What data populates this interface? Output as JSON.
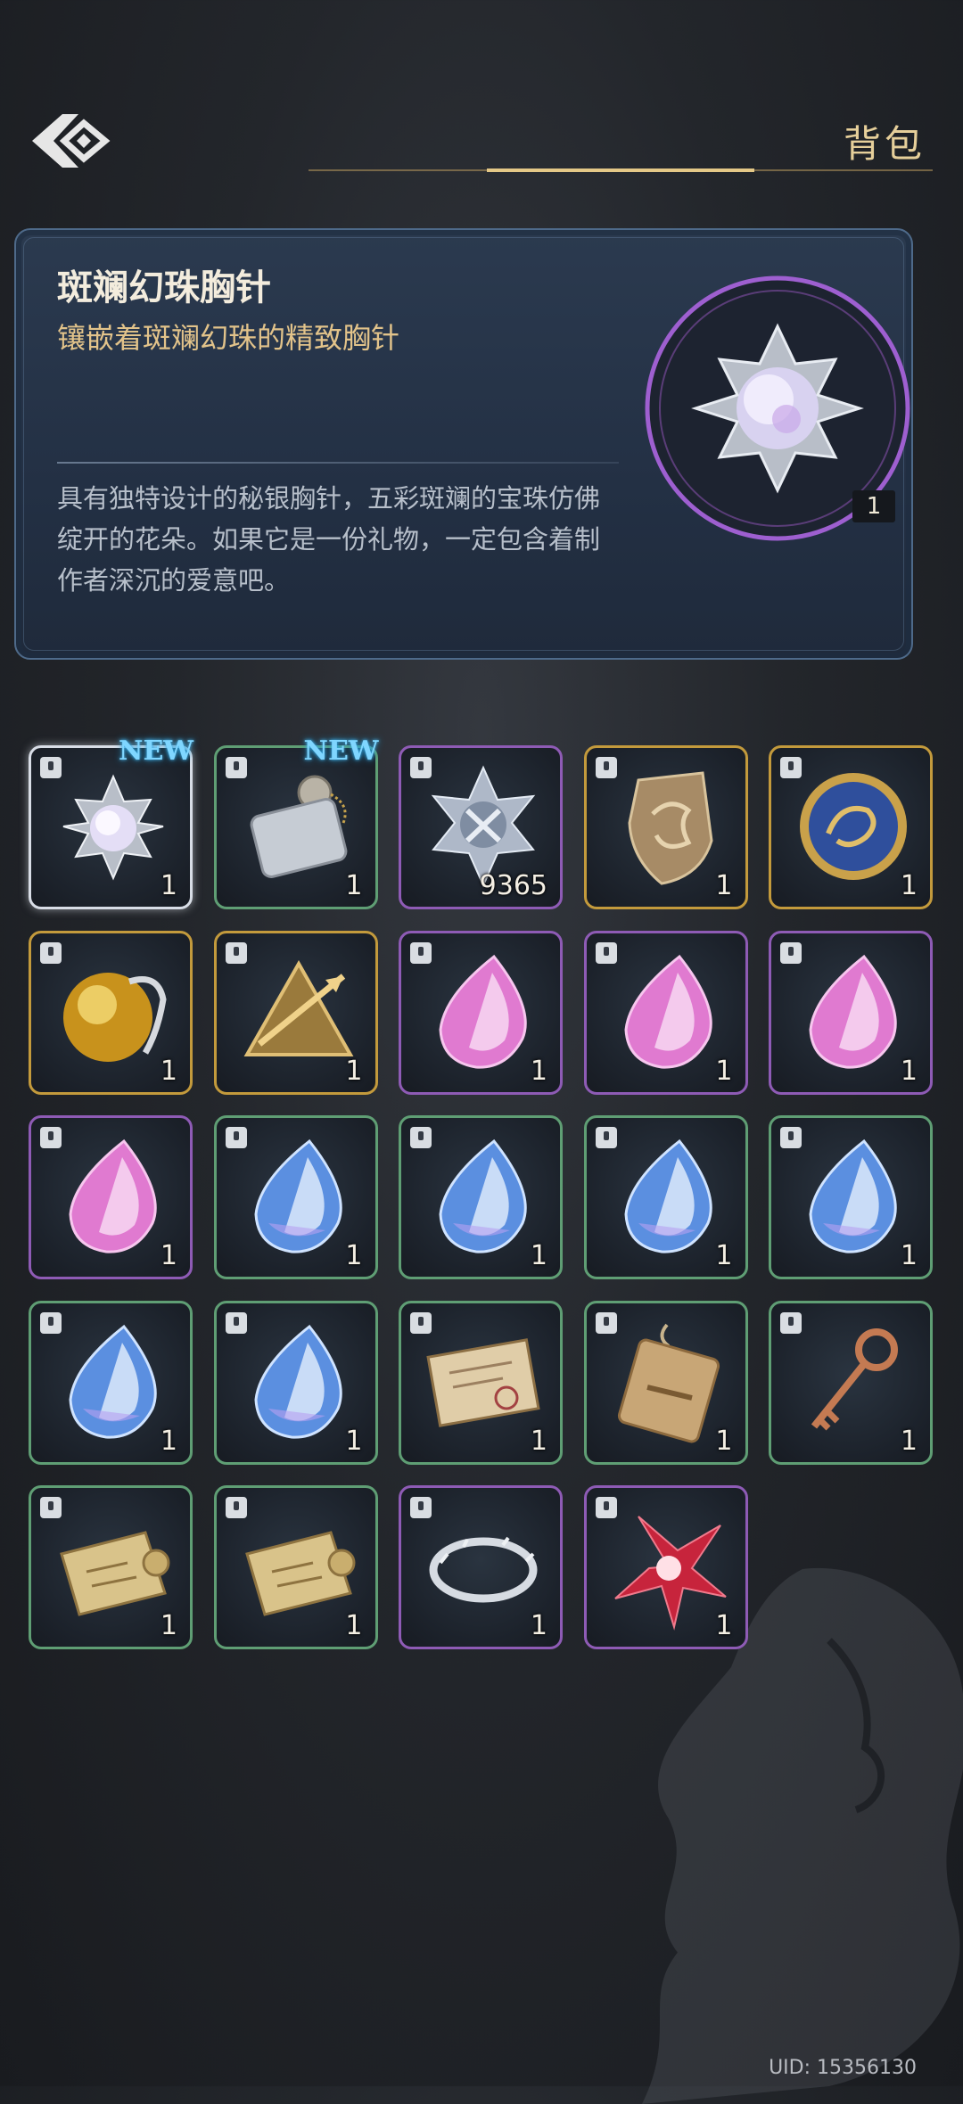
{
  "header": {
    "title": "背包"
  },
  "detail": {
    "name": "斑斓幻珠胸针",
    "subtitle": "镶嵌着斑斓幻珠的精致胸针",
    "description": "具有独特设计的秘银胸针，五彩斑斓的宝珠仿佛绽开的花朵。如果它是一份礼物，一定包含着制作者深沉的爱意吧。",
    "count": "1"
  },
  "inventory": {
    "new_label": "NEW",
    "items": [
      {
        "icon": "brooch-icon",
        "rarity": "silver",
        "count": "1",
        "new": true
      },
      {
        "icon": "dog-tag-icon",
        "rarity": "green",
        "count": "1",
        "new": true
      },
      {
        "icon": "silver-star-emblem-icon",
        "rarity": "purple",
        "count": "9365",
        "new": false
      },
      {
        "icon": "dragon-shield-icon",
        "rarity": "gold",
        "count": "1",
        "new": false
      },
      {
        "icon": "blue-dragon-coin-icon",
        "rarity": "gold",
        "count": "1",
        "new": false
      },
      {
        "icon": "amber-orb-icon",
        "rarity": "gold",
        "count": "1",
        "new": false
      },
      {
        "icon": "golden-arrow-emblem-icon",
        "rarity": "gold",
        "count": "1",
        "new": false
      },
      {
        "icon": "pink-gem-icon",
        "rarity": "purple",
        "count": "1",
        "new": false
      },
      {
        "icon": "pink-gem-icon",
        "rarity": "purple",
        "count": "1",
        "new": false
      },
      {
        "icon": "pink-gem-icon",
        "rarity": "purple",
        "count": "1",
        "new": false
      },
      {
        "icon": "pink-gem-icon",
        "rarity": "purple",
        "count": "1",
        "new": false
      },
      {
        "icon": "blue-gem-icon",
        "rarity": "green",
        "count": "1",
        "new": false
      },
      {
        "icon": "blue-gem-icon",
        "rarity": "green",
        "count": "1",
        "new": false
      },
      {
        "icon": "blue-gem-icon",
        "rarity": "green",
        "count": "1",
        "new": false
      },
      {
        "icon": "blue-gem-icon",
        "rarity": "green",
        "count": "1",
        "new": false
      },
      {
        "icon": "blue-gem-icon",
        "rarity": "green",
        "count": "1",
        "new": false
      },
      {
        "icon": "blue-gem-icon",
        "rarity": "green",
        "count": "1",
        "new": false
      },
      {
        "icon": "letter-icon",
        "rarity": "green",
        "count": "1",
        "new": false
      },
      {
        "icon": "wooden-tag-icon",
        "rarity": "green",
        "count": "1",
        "new": false
      },
      {
        "icon": "bronze-key-icon",
        "rarity": "green",
        "count": "1",
        "new": false
      },
      {
        "icon": "map-scroll-icon",
        "rarity": "green",
        "count": "1",
        "new": false
      },
      {
        "icon": "map-scroll-icon",
        "rarity": "green",
        "count": "1",
        "new": false
      },
      {
        "icon": "silver-ring-icon",
        "rarity": "purple",
        "count": "1",
        "new": false
      },
      {
        "icon": "red-flower-icon",
        "rarity": "purple",
        "count": "1",
        "new": false
      }
    ]
  },
  "footer": {
    "uid": "UID: 15356130"
  },
  "colors": {
    "green": "#5f9e74",
    "purple": "#8e5bb5",
    "gold": "#c39a3c",
    "accent": "#e6cf9a"
  }
}
